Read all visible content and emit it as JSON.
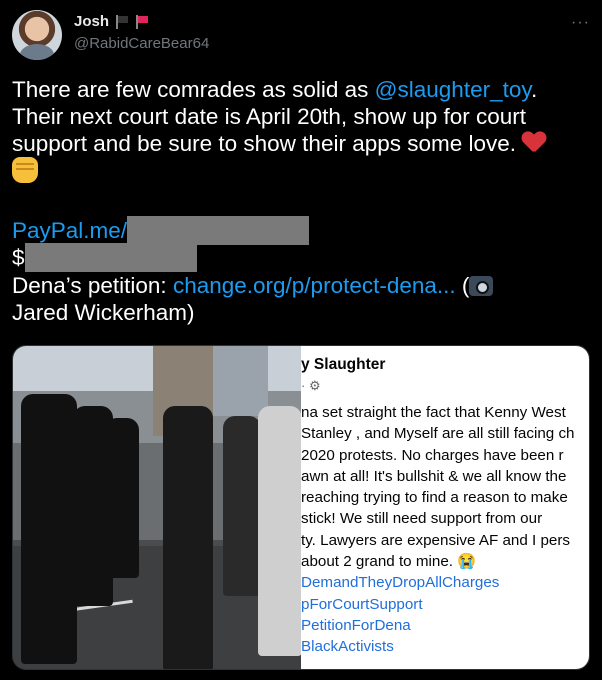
{
  "tweet": {
    "display_name": "Josh",
    "handle": "@RabidCareBear64",
    "more_label": "···",
    "flag_colors": [
      "#333333",
      "#e0245e"
    ],
    "text": {
      "line1_pre": "There are few comrades as solid as ",
      "mention": "@slaughter_toy",
      "line1_post": ".",
      "line2": "Their next court date is April 20th, show up for court",
      "line3": "support and be sure to show their apps some love.",
      "paypal": "PayPal.me/",
      "dollar": "$",
      "petition_label": "Dena’s petition: ",
      "petition_link": "change.org/p/protect-dena...",
      "credit_open": " (",
      "credit_rest": "Jared Wickerham)"
    }
  },
  "media": {
    "photo_icon": "protest-photo",
    "post": {
      "author": "y Slaughter",
      "meta": "· ⚙",
      "lines": [
        "na set straight the fact that Kenny West",
        "Stanley , and Myself are all still facing ch",
        "2020 protests. No charges have been r",
        "awn at all! It's bullshit & we all know the",
        " reaching trying to find a reason to make",
        "stick! We still need support from our",
        "ty. Lawyers are expensive AF and I pers",
        "about 2 grand to mine. 😭"
      ],
      "hashtags": [
        "DemandTheyDropAllCharges",
        "pForCourtSupport",
        "PetitionForDena",
        "BlackActivists"
      ]
    }
  },
  "colors": {
    "accent": "#1d9bf0",
    "background": "#000000",
    "heart": "#d8323a"
  }
}
